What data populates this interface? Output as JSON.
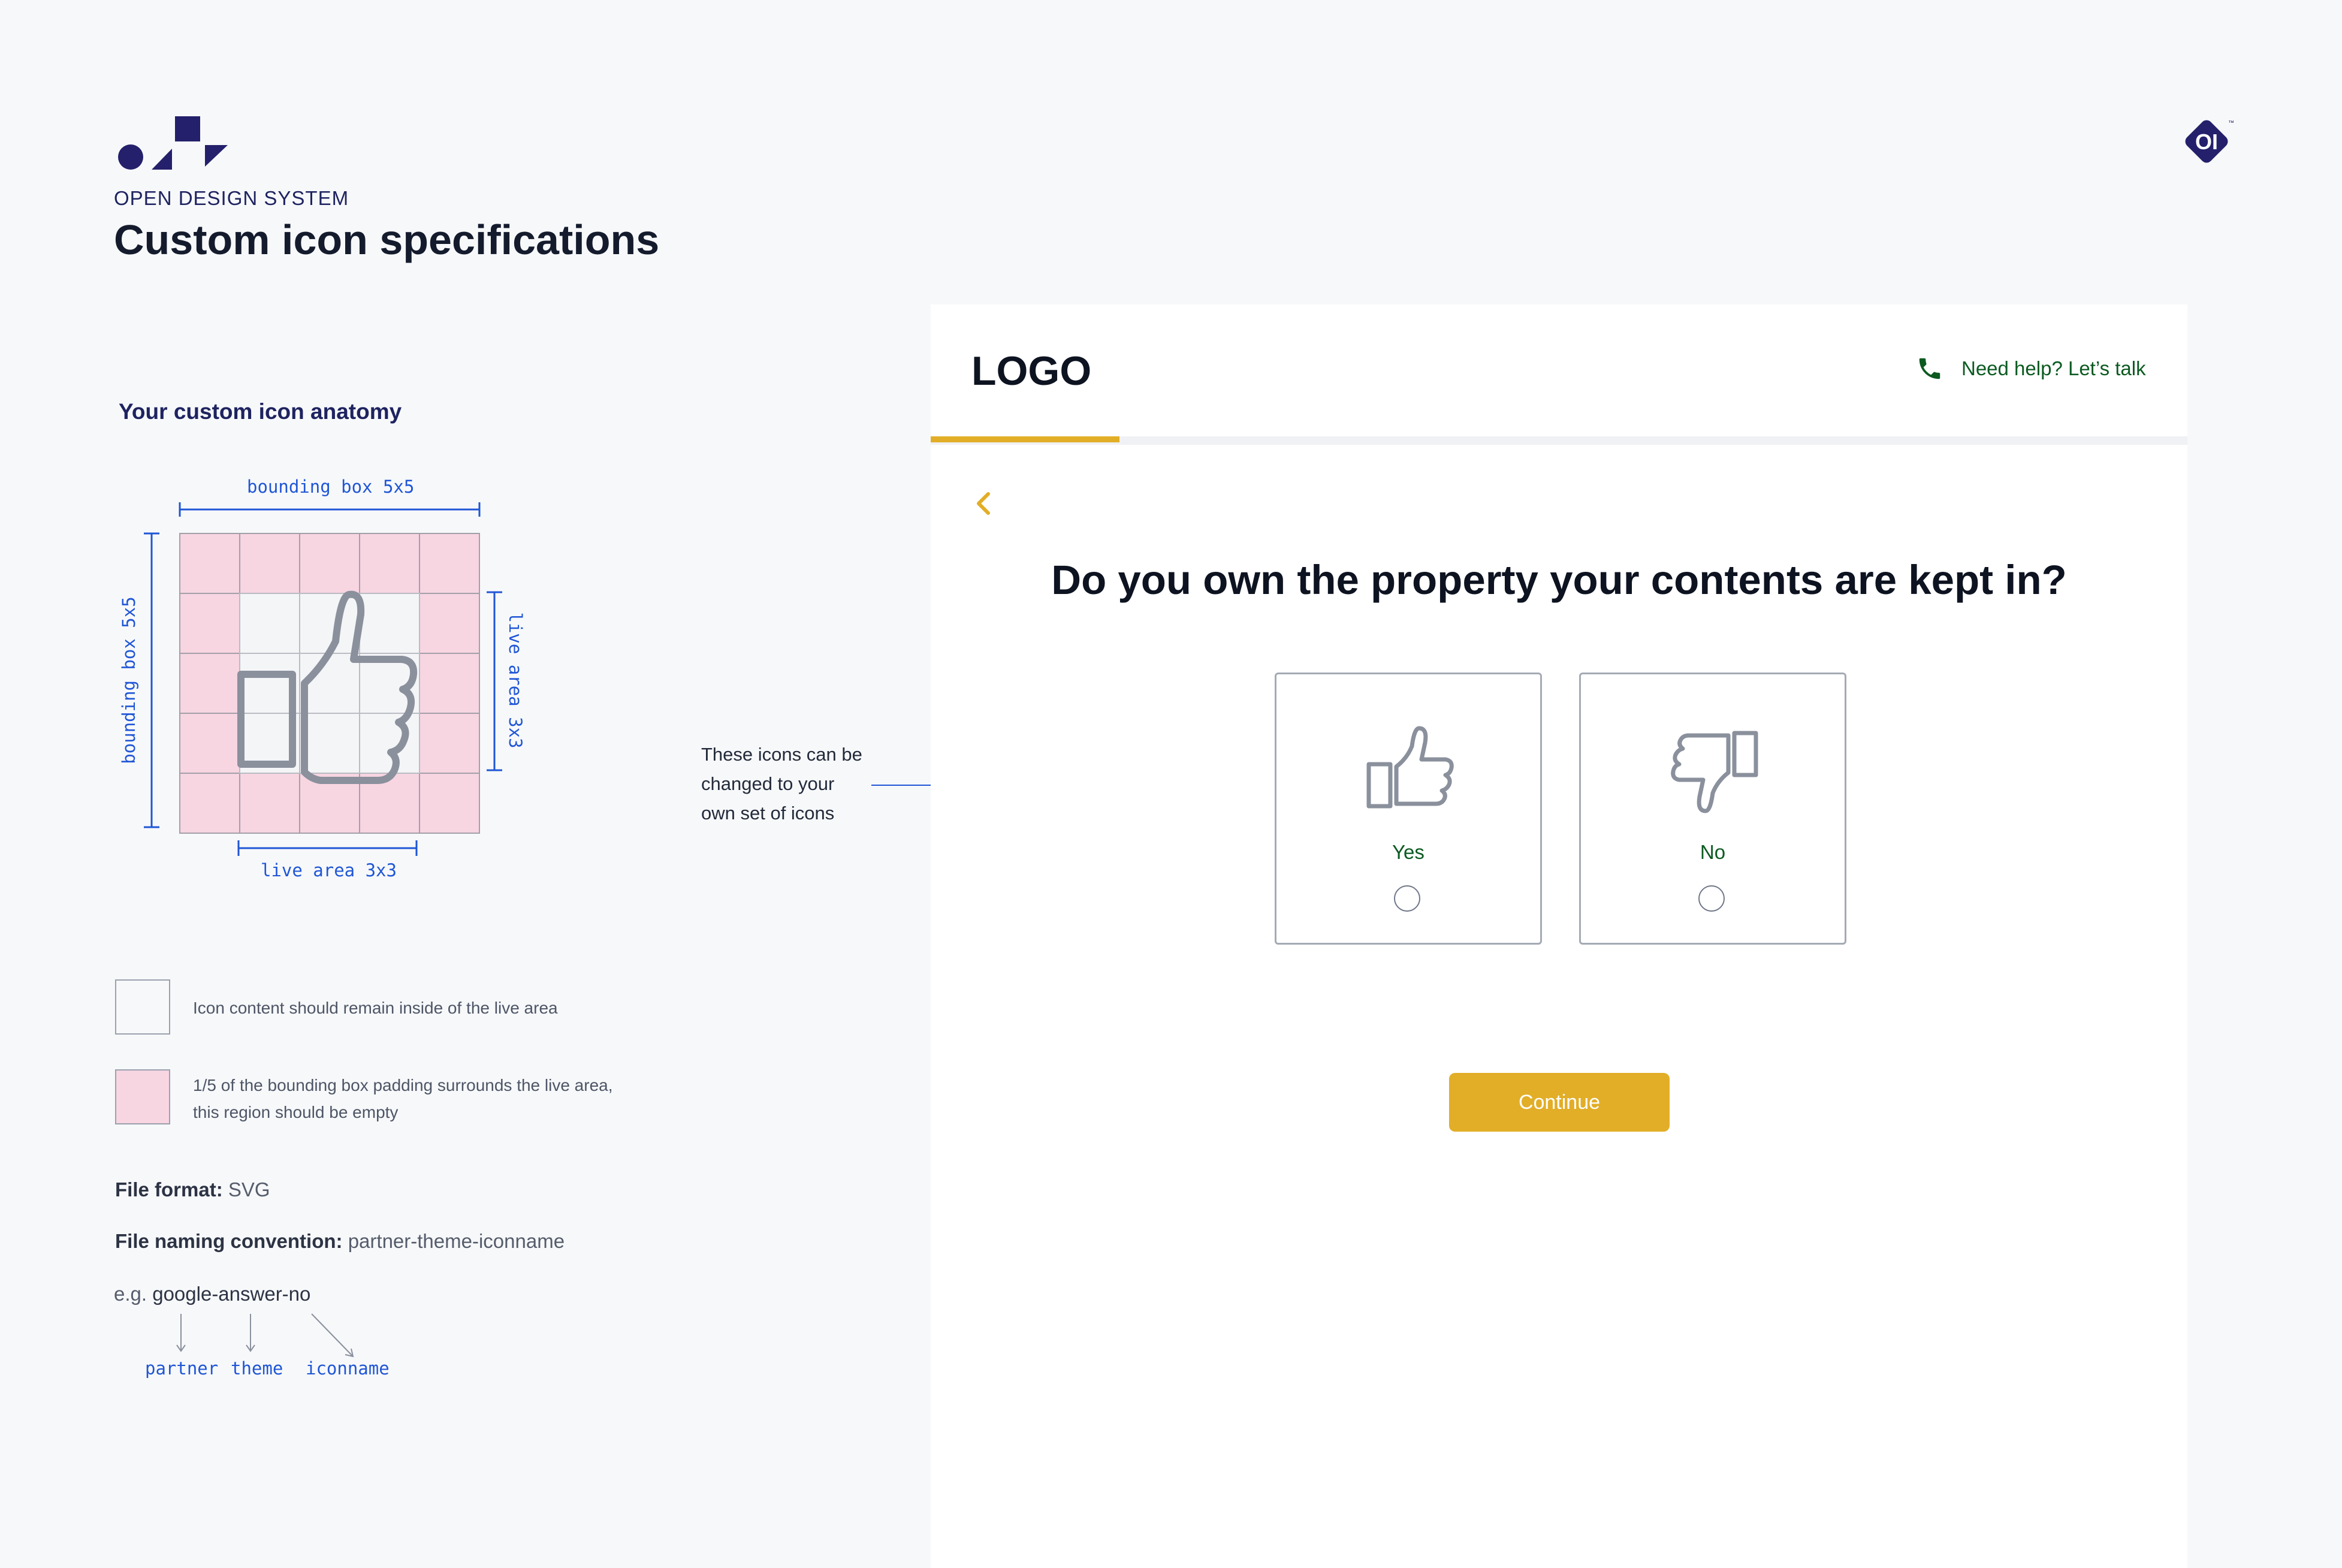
{
  "brand": {
    "kicker": "OPEN DESIGN SYSTEM",
    "title": "Custom icon specifications",
    "corner_badge": "OI"
  },
  "anatomy": {
    "heading": "Your custom icon anatomy",
    "bounding_box_label_top": "bounding box 5x5",
    "bounding_box_label_left": "bounding box 5x5",
    "live_area_label_right": "live area 3x3",
    "live_area_label_bottom": "live area 3x3",
    "grid_icon": "thumbs-up-outline-icon",
    "colors": {
      "padding": "#f7d5e1",
      "live_area": "#f4f5f7",
      "dimension": "#1f56d6"
    }
  },
  "legend": [
    {
      "swatch": "#f7f8fa",
      "text": "Icon content should remain inside of the live area"
    },
    {
      "swatch": "#f7d5e1",
      "text_line1": "1/5 of the bounding box padding surrounds the live area,",
      "text_line2": "this region should be empty"
    }
  ],
  "spec": {
    "format_label": "File format:",
    "format_value": "SVG",
    "naming_label": "File naming convention:",
    "naming_value": "partner-theme-iconname",
    "example_prefix": "e.g.",
    "example_value": "google-answer-no",
    "parts": [
      "partner",
      "theme",
      "iconname"
    ]
  },
  "callout": {
    "line1": "These icons can be",
    "line2": "changed to your",
    "line3": "own set of icons"
  },
  "panel": {
    "logo": "LOGO",
    "help_text": "Need help? Let’s talk",
    "progress": 0.15,
    "question": "Do you own the property your contents are kept in?",
    "options": [
      {
        "label": "Yes",
        "icon": "thumbs-up-icon",
        "selected": false
      },
      {
        "label": "No",
        "icon": "thumbs-down-icon",
        "selected": false
      }
    ],
    "continue_label": "Continue",
    "accent_color": "#e2ae28",
    "link_color": "#0b5a20"
  }
}
